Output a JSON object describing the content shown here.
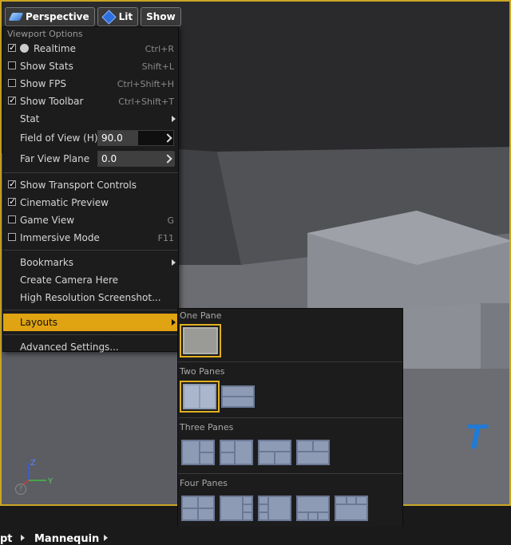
{
  "toolbar": {
    "perspective_label": "Perspective",
    "lit_label": "Lit",
    "show_label": "Show"
  },
  "menu": {
    "section_title": "Viewport Options",
    "items": [
      {
        "label": "Realtime",
        "shortcut": "Ctrl+R",
        "checked": true
      },
      {
        "label": "Show Stats",
        "shortcut": "Shift+L",
        "checked": false
      },
      {
        "label": "Show FPS",
        "shortcut": "Ctrl+Shift+H",
        "checked": false
      },
      {
        "label": "Show Toolbar",
        "shortcut": "Ctrl+Shift+T",
        "checked": true
      }
    ],
    "stat_label": "Stat",
    "fov_label": "Field of View (H)",
    "fov_value": "90.0",
    "far_label": "Far View Plane",
    "far_value": "0.0",
    "items2": [
      {
        "label": "Show Transport Controls",
        "shortcut": "",
        "checked": true
      },
      {
        "label": "Cinematic Preview",
        "shortcut": "",
        "checked": true
      },
      {
        "label": "Game View",
        "shortcut": "G",
        "checked": false
      },
      {
        "label": "Immersive Mode",
        "shortcut": "F11",
        "checked": false
      }
    ],
    "bookmarks_label": "Bookmarks",
    "create_camera_label": "Create Camera Here",
    "screenshot_label": "High Resolution Screenshot...",
    "layouts_label": "Layouts",
    "advanced_label": "Advanced Settings..."
  },
  "layouts": {
    "one_pane": "One Pane",
    "two_panes": "Two Panes",
    "three_panes": "Three Panes",
    "four_panes": "Four Panes"
  },
  "bottom": {
    "crumb1": "pt",
    "crumb2": "Mannequin"
  },
  "axes": {
    "z": "Z",
    "y": "Y"
  },
  "help_glyph": "?",
  "colors": {
    "accent": "#e0a311",
    "selection_outline": "#e0b020"
  }
}
